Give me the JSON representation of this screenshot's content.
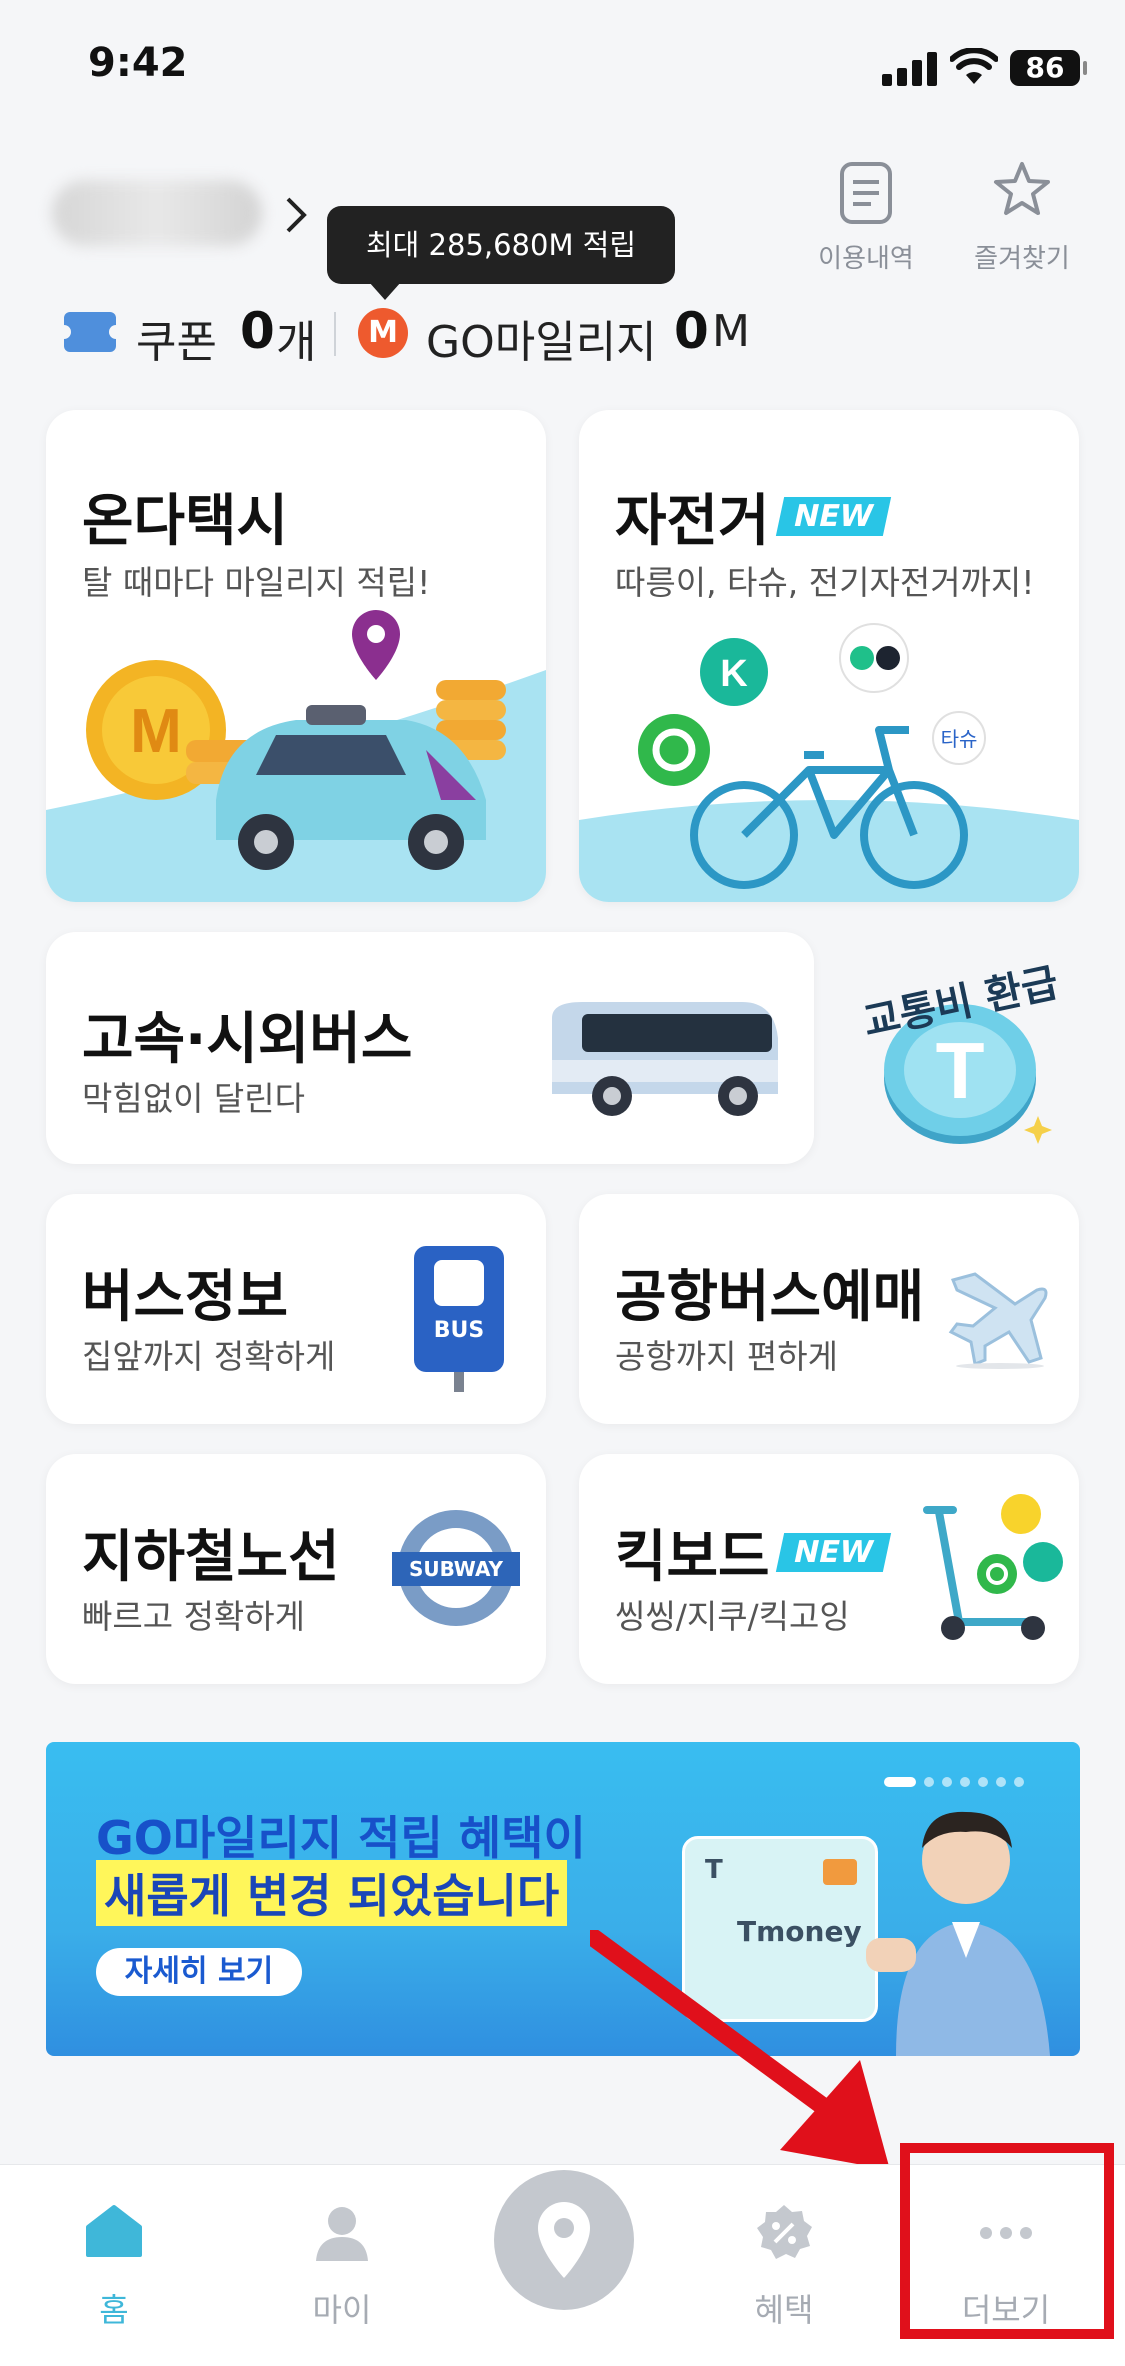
{
  "status_bar": {
    "time": "9:42",
    "battery": "86"
  },
  "header": {
    "tooltip": "최대 285,680M 적립",
    "history_label": "이용내역",
    "favorites_label": "즐겨찾기"
  },
  "points": {
    "coupon_label": "쿠폰",
    "coupon_count": "0",
    "coupon_unit": "개",
    "mileage_icon": "M",
    "mileage_label": "GO마일리지",
    "mileage_value": "0",
    "mileage_unit": "M"
  },
  "cards": {
    "taxi": {
      "title": "온다택시",
      "subtitle": "탈 때마다 마일리지 적립!"
    },
    "bike": {
      "title": "자전거",
      "badge": "NEW",
      "subtitle": "따릉이, 타슈, 전기자전거까지!"
    },
    "express_bus": {
      "title": "고속·시외버스",
      "subtitle": "막힘없이 달린다"
    },
    "refund": {
      "label": "교통비 환급"
    },
    "bus_info": {
      "title": "버스정보",
      "subtitle": "집앞까지 정확하게",
      "sign": "BUS"
    },
    "airport_bus": {
      "title": "공항버스예매",
      "subtitle": "공항까지 편하게"
    },
    "subway": {
      "title": "지하철노선",
      "subtitle": "빠르고 정확하게",
      "sign": "SUBWAY"
    },
    "kickboard": {
      "title": "킥보드",
      "badge": "NEW",
      "subtitle": "씽씽/지쿠/킥고잉"
    }
  },
  "banner": {
    "line1": "GO마일리지 적립 혜택이",
    "line2": "새롭게 변경 되었습니다",
    "button": "자세히 보기",
    "card_brand": "Tmoney"
  },
  "bottom_nav": [
    {
      "label": "홈",
      "active": true
    },
    {
      "label": "마이",
      "active": false
    },
    {
      "label": "혜택",
      "active": false
    },
    {
      "label": "더보기",
      "active": false
    }
  ],
  "colors": {
    "accent": "#3fb7d9",
    "inactive": "#a6abb3",
    "annotation": "#e0101b"
  }
}
